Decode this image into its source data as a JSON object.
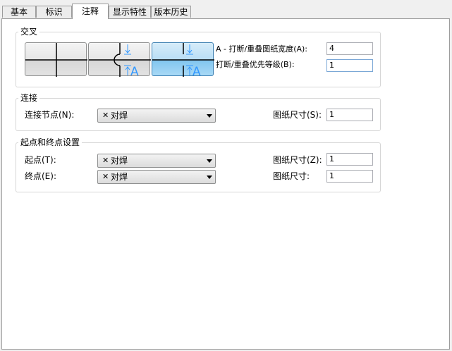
{
  "tabs": [
    {
      "label": "基本"
    },
    {
      "label": "标识"
    },
    {
      "label": "注释"
    },
    {
      "label": "显示特性"
    },
    {
      "label": "版本历史"
    }
  ],
  "active_tab": "注释",
  "crossing": {
    "title": "交叉",
    "options": [
      "none",
      "jog",
      "break"
    ],
    "selected_option": "break",
    "break_width_label": "A - 打断/重叠图纸宽度(A):",
    "break_width_value": "4",
    "priority_label": "打断/重叠优先等级(B):",
    "priority_value": "1",
    "glyph_a": "A"
  },
  "connection": {
    "title": "连接",
    "node_label": "连接节点(N):",
    "node_symbol": "✕",
    "node_value": "对焊",
    "size_label": "图纸尺寸(S):",
    "size_value": "1"
  },
  "endpoints": {
    "title": "起点和终点设置",
    "start_label": "起点(T):",
    "start_symbol": "✕",
    "start_value": "对焊",
    "start_size_label": "图纸尺寸(Z):",
    "start_size_value": "1",
    "end_label": "终点(E):",
    "end_symbol": "✕",
    "end_value": "对焊",
    "end_size_label": "图纸尺寸:",
    "end_size_value": "1"
  },
  "colors": {
    "accent": "#3399ff",
    "line": "#000000",
    "selected_bg": "#b9def5"
  }
}
